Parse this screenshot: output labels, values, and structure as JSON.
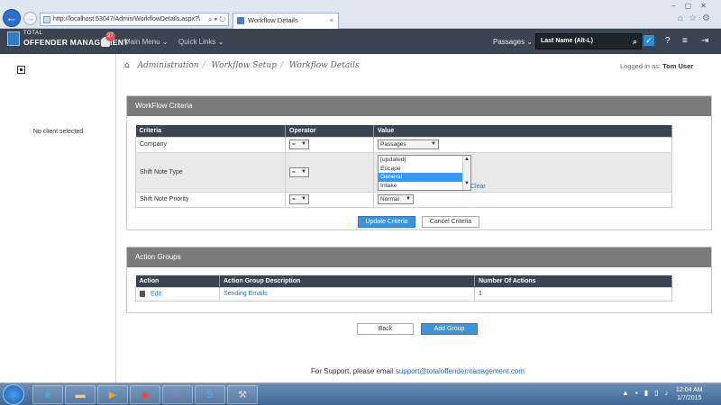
{
  "browser": {
    "url": "http://localhost:53047/Admin/WorkflowDetails.aspx?\\",
    "tab_title": "Workflow Details",
    "tab_close": "×"
  },
  "header": {
    "brand_line1": "TOTAL",
    "brand_line2": "OFFENDER MANAGEMENT",
    "notification_count": "27",
    "main_menu": "Main Menu ⌄",
    "quick_links": "Quick Links ⌄",
    "passages": "Passages ⌄",
    "search_placeholder": "Last Name (Alt-L)"
  },
  "sidebar": {
    "no_client": "No client selected"
  },
  "breadcrumb": {
    "items": [
      "Administration",
      "Workflow Setup",
      "Workflow Details"
    ]
  },
  "logged_in": {
    "label": "Logged in as:",
    "user": "Tom User"
  },
  "criteria_panel": {
    "title": "WorkFlow Criteria",
    "columns": [
      "Criteria",
      "Operator",
      "Value"
    ],
    "rows": [
      {
        "criteria": "Company",
        "operator": "=",
        "value": "Passages"
      },
      {
        "criteria": "Shift Note Type",
        "operator": "=",
        "value": ""
      },
      {
        "criteria": "Shift Note Priority",
        "operator": "=",
        "value": "Normal"
      }
    ],
    "listbox_options": [
      "[updated]",
      "Escape",
      "General",
      "Intake"
    ],
    "listbox_selected": "General",
    "clear_link": "Clear",
    "update_button": "Update Criteria",
    "cancel_button": "Cancel Criteria"
  },
  "action_groups": {
    "title": "Action Groups",
    "columns": [
      "Action",
      "Action Group Description",
      "Number Of Actions"
    ],
    "rows": [
      {
        "action": "Edit",
        "description": "Sending Emails",
        "count": "1"
      }
    ],
    "back_button": "Back",
    "add_button": "Add Group"
  },
  "footer": {
    "support_text": "For Support, please email",
    "support_email": "support@totaloffendermanagement.com"
  },
  "taskbar": {
    "time": "12:04 AM",
    "date": "1/7/2015"
  },
  "colors": {
    "header_bg": "#3b4451",
    "panel_header_bg": "#7a7a7a",
    "accent_blue": "#3f94d8",
    "link": "#2a6db5"
  }
}
